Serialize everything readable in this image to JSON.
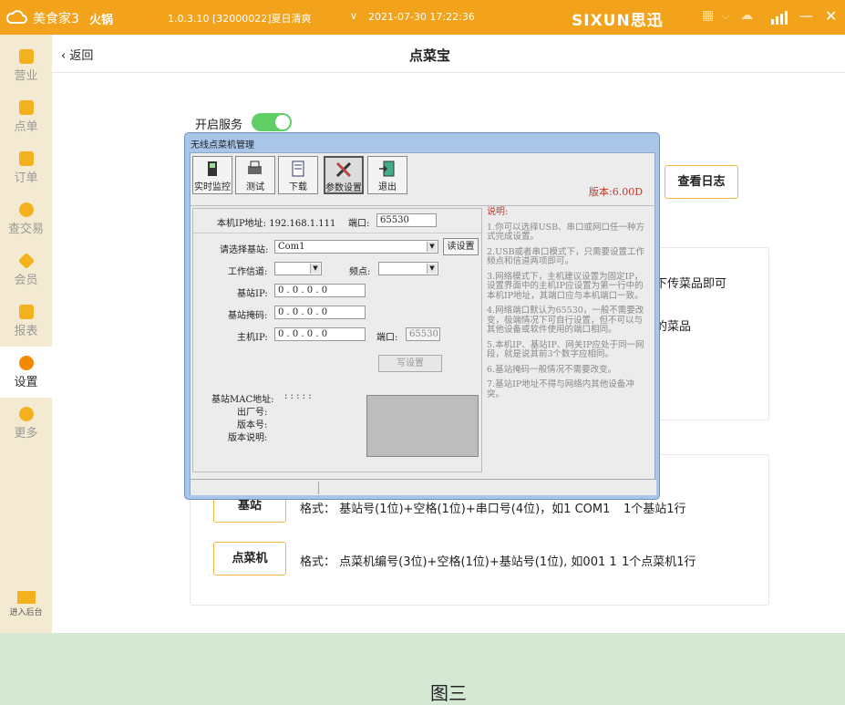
{
  "topbar": {
    "app_name": "美食家3",
    "shop": "火锅",
    "version_info": "1.0.3.10 [32000022]夏日清爽",
    "datetime": "2021-07-30 17:22:36",
    "brand": "SIXUN思迅",
    "chevron": "∨",
    "grid_chevron": "⌵",
    "min": "—",
    "close": "✕"
  },
  "sidebar": {
    "items": [
      {
        "label": "营业",
        "icon": "shop-icon"
      },
      {
        "label": "点单",
        "icon": "hand-icon"
      },
      {
        "label": "订单",
        "icon": "list-icon"
      },
      {
        "label": "查交易",
        "icon": "search-icon"
      },
      {
        "label": "会员",
        "icon": "diamond-icon"
      },
      {
        "label": "报表",
        "icon": "report-icon"
      },
      {
        "label": "设置",
        "icon": "gear-icon"
      },
      {
        "label": "更多",
        "icon": "more-icon"
      }
    ],
    "backend": "进入后台"
  },
  "subhead": {
    "back": "‹ 返回",
    "title": "点菜宝"
  },
  "main": {
    "service_label": "开启服务",
    "service_on": true,
    "log_button": "查看日志",
    "behind_text_1": "下传菜品即可",
    "behind_text_2": "的菜品",
    "base_button": "基站",
    "base_format": "格式：  基站号(1位)+空格(1位)+串口号(4位)，如1 COM1",
    "base_count": "1个基站1行",
    "device_button": "点菜机",
    "device_format": "格式：  点菜机编号(3位)+空格(1位)+基站号(1位), 如001 1",
    "device_count": "1个点菜机1行"
  },
  "dialog": {
    "title": "无线点菜机管理",
    "tools": [
      "实时监控",
      "测试",
      "下载",
      "参数设置",
      "退出"
    ],
    "version": "版本:6.00D",
    "local_ip_label": "本机IP地址: 192.168.1.111",
    "port_label": "端口:",
    "port_value": "65530",
    "select_base_label": "请选择基站:",
    "base_value": "Com1",
    "read_button": "读设置",
    "channel_label": "工作信道:",
    "freq_label": "频点:",
    "base_ip_label": "基站IP:",
    "base_mask_label": "基站掩码:",
    "host_ip_label": "主机IP:",
    "ip_placeholder": "0  .  0  .  0  .  0",
    "port2_label": "端口:",
    "port2_value": "65530",
    "write_button": "写设置",
    "mac_label": "基站MAC地址:",
    "mac_value": ":  :  :  :  :",
    "factory_label": "出厂号:",
    "ver_label": "版本号:",
    "ver_desc_label": "版本说明:",
    "help_title": "说明:",
    "help": [
      "1.你可以选择USB、串口或网口任一种方式完成设置。",
      "2.USB或者串口模式下，只需要设置工作频点和信道两项即可。",
      "3.网络模式下，主机建议设置为固定IP，设置界面中的主机IP应设置为第一行中的本机IP地址，其端口应与本机端口一致。",
      "4.网络端口默认为65530，一般不需要改变，极端情况下可自行设置，但不可以与其他设备或软件使用的端口相同。",
      "5.本机IP、基站IP、网关IP应处于同一网段，就是说其前3个数字应相同。",
      "6.基站掩码一般情况不需要改变。",
      "7.基站IP地址不得与网络内其他设备冲突。"
    ]
  },
  "footer": {
    "caption": "图三"
  }
}
